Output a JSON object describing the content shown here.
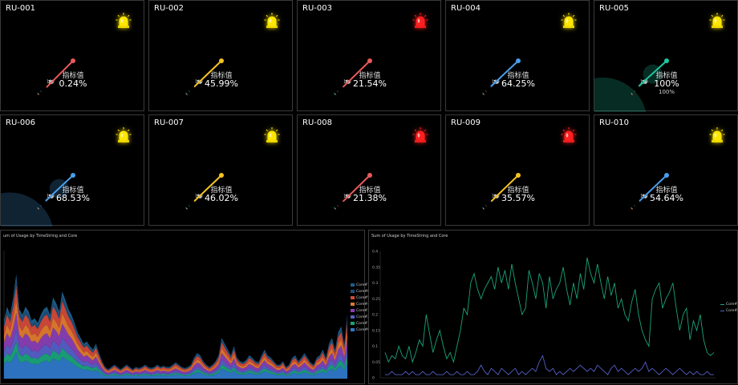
{
  "gauge_label": "指标值",
  "gauge_scale": [
    "0",
    "25",
    "50",
    "75",
    "100"
  ],
  "gauges": [
    {
      "id": "RU-001",
      "value": 0.24,
      "display": "0.24%",
      "alarm": "yellow",
      "sub": ""
    },
    {
      "id": "RU-002",
      "value": 45.99,
      "display": "45.99%",
      "alarm": "yellow",
      "sub": ""
    },
    {
      "id": "RU-003",
      "value": 21.54,
      "display": "21.54%",
      "alarm": "red",
      "sub": ""
    },
    {
      "id": "RU-004",
      "value": 64.25,
      "display": "64.25%",
      "alarm": "yellow",
      "sub": ""
    },
    {
      "id": "RU-005",
      "value": 100,
      "display": "100%",
      "alarm": "yellow",
      "sub": "100%"
    },
    {
      "id": "RU-006",
      "value": 68.53,
      "display": "68.53%",
      "alarm": "yellow",
      "sub": ""
    },
    {
      "id": "RU-007",
      "value": 46.02,
      "display": "46.02%",
      "alarm": "yellow",
      "sub": ""
    },
    {
      "id": "RU-008",
      "value": 21.38,
      "display": "21.38%",
      "alarm": "red",
      "sub": ""
    },
    {
      "id": "RU-009",
      "value": 35.57,
      "display": "35.57%",
      "alarm": "red",
      "sub": ""
    },
    {
      "id": "RU-010",
      "value": 54.64,
      "display": "54.64%",
      "alarm": "yellow",
      "sub": ""
    }
  ],
  "colors": {
    "low": "#e85a5a",
    "mid": "#f5c323",
    "high": "#4a9eea",
    "top": "#1ec8a0",
    "alarm_yellow": "#ffe600",
    "alarm_red": "#ff1f1f"
  },
  "left_panel": {
    "title": "um of Usage by TimeString and Core",
    "chart_data": {
      "type": "area",
      "series": [
        {
          "name": "Core#1",
          "color": "#1b5e8a"
        },
        {
          "name": "Core#6",
          "color": "#1f4f7a"
        },
        {
          "name": "Core#5",
          "color": "#d24a3a"
        },
        {
          "name": "Core#4",
          "color": "#e07a2e"
        },
        {
          "name": "Core#3",
          "color": "#8a3fb5"
        },
        {
          "name": "Core#2",
          "color": "#5560c8"
        },
        {
          "name": "Core#1",
          "color": "#1aa37a"
        },
        {
          "name": "Core#0",
          "color": "#2f78c8"
        }
      ],
      "total": [
        0.5,
        0.62,
        0.55,
        0.7,
        0.9,
        0.6,
        0.55,
        0.62,
        0.58,
        0.5,
        0.52,
        0.48,
        0.55,
        0.6,
        0.62,
        0.55,
        0.7,
        0.65,
        0.58,
        0.75,
        0.68,
        0.6,
        0.55,
        0.48,
        0.4,
        0.35,
        0.3,
        0.32,
        0.28,
        0.25,
        0.3,
        0.22,
        0.15,
        0.1,
        0.08,
        0.1,
        0.12,
        0.1,
        0.08,
        0.1,
        0.12,
        0.1,
        0.08,
        0.1,
        0.09,
        0.1,
        0.12,
        0.1,
        0.09,
        0.1,
        0.12,
        0.1,
        0.11,
        0.1,
        0.1,
        0.12,
        0.14,
        0.12,
        0.1,
        0.09,
        0.1,
        0.12,
        0.18,
        0.22,
        0.2,
        0.15,
        0.12,
        0.1,
        0.12,
        0.15,
        0.2,
        0.35,
        0.3,
        0.25,
        0.2,
        0.28,
        0.18,
        0.15,
        0.14,
        0.16,
        0.2,
        0.18,
        0.15,
        0.14,
        0.2,
        0.25,
        0.2,
        0.18,
        0.15,
        0.12,
        0.12,
        0.15,
        0.1,
        0.12,
        0.18,
        0.2,
        0.15,
        0.18,
        0.22,
        0.18,
        0.14,
        0.12,
        0.18,
        0.2,
        0.25,
        0.18,
        0.3,
        0.35,
        0.25,
        0.4,
        0.45,
        0.3,
        0.55
      ]
    }
  },
  "right_panel": {
    "title": "Sum of Usage by TimeString and Core",
    "chart_data": {
      "type": "line",
      "yticks": [
        "0.4",
        "0.35",
        "0.3",
        "0.25",
        "0.2",
        "0.15",
        "0.1",
        "0.05",
        "0"
      ],
      "ylim": [
        0,
        0.4
      ],
      "series": [
        {
          "name": "Core#1",
          "color": "#1aa37a",
          "values": [
            0.08,
            0.05,
            0.07,
            0.06,
            0.1,
            0.07,
            0.06,
            0.1,
            0.05,
            0.08,
            0.12,
            0.1,
            0.2,
            0.14,
            0.08,
            0.12,
            0.15,
            0.1,
            0.06,
            0.08,
            0.05,
            0.1,
            0.15,
            0.22,
            0.2,
            0.3,
            0.33,
            0.28,
            0.25,
            0.28,
            0.3,
            0.32,
            0.28,
            0.35,
            0.3,
            0.34,
            0.28,
            0.36,
            0.3,
            0.25,
            0.2,
            0.22,
            0.34,
            0.3,
            0.25,
            0.33,
            0.3,
            0.22,
            0.32,
            0.25,
            0.28,
            0.3,
            0.35,
            0.28,
            0.23,
            0.3,
            0.25,
            0.33,
            0.28,
            0.38,
            0.33,
            0.3,
            0.36,
            0.3,
            0.25,
            0.32,
            0.26,
            0.3,
            0.22,
            0.25,
            0.2,
            0.18,
            0.24,
            0.28,
            0.2,
            0.15,
            0.12,
            0.1,
            0.25,
            0.28,
            0.3,
            0.22,
            0.25,
            0.27,
            0.3,
            0.22,
            0.15,
            0.2,
            0.22,
            0.12,
            0.18,
            0.15,
            0.2,
            0.12,
            0.08,
            0.07,
            0.08
          ]
        },
        {
          "name": "Core#2",
          "color": "#5560c8",
          "values": [
            0.01,
            0.01,
            0.02,
            0.01,
            0.01,
            0.01,
            0.02,
            0.01,
            0.02,
            0.01,
            0.01,
            0.02,
            0.01,
            0.01,
            0.02,
            0.01,
            0.01,
            0.01,
            0.02,
            0.01,
            0.01,
            0.02,
            0.01,
            0.01,
            0.02,
            0.01,
            0.01,
            0.02,
            0.04,
            0.02,
            0.01,
            0.03,
            0.02,
            0.01,
            0.03,
            0.02,
            0.01,
            0.02,
            0.03,
            0.01,
            0.02,
            0.01,
            0.02,
            0.03,
            0.02,
            0.05,
            0.07,
            0.03,
            0.02,
            0.03,
            0.01,
            0.02,
            0.01,
            0.02,
            0.03,
            0.02,
            0.03,
            0.04,
            0.03,
            0.02,
            0.03,
            0.02,
            0.04,
            0.03,
            0.02,
            0.01,
            0.03,
            0.04,
            0.02,
            0.03,
            0.02,
            0.01,
            0.02,
            0.03,
            0.02,
            0.03,
            0.05,
            0.02,
            0.03,
            0.02,
            0.01,
            0.02,
            0.03,
            0.02,
            0.01,
            0.02,
            0.03,
            0.02,
            0.01,
            0.02,
            0.01,
            0.02,
            0.01,
            0.01,
            0.02,
            0.01,
            0.01
          ]
        }
      ]
    }
  }
}
